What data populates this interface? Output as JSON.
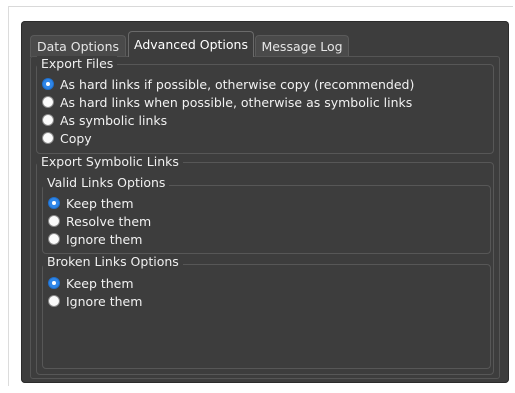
{
  "tabs": [
    {
      "label": "Data Options",
      "active": false
    },
    {
      "label": "Advanced Options",
      "active": true
    },
    {
      "label": "Message Log",
      "active": false
    }
  ],
  "export_files": {
    "title": "Export Files",
    "options": [
      {
        "label": "As hard links if possible, otherwise copy (recommended)",
        "selected": true
      },
      {
        "label": "As hard links when possible, otherwise as symbolic links",
        "selected": false
      },
      {
        "label": "As symbolic links",
        "selected": false
      },
      {
        "label": "Copy",
        "selected": false
      }
    ]
  },
  "export_symbolic_links": {
    "title": "Export Symbolic Links",
    "valid_links": {
      "title": "Valid Links Options",
      "options": [
        {
          "label": "Keep them",
          "selected": true
        },
        {
          "label": "Resolve them",
          "selected": false
        },
        {
          "label": "Ignore them",
          "selected": false
        }
      ]
    },
    "broken_links": {
      "title": "Broken Links Options",
      "options": [
        {
          "label": "Keep them",
          "selected": true
        },
        {
          "label": "Ignore them",
          "selected": false
        }
      ]
    }
  },
  "colors": {
    "panel_bg": "#3d3d3d",
    "accent_radio": "#2f86e8",
    "text": "#f2f2f2"
  }
}
